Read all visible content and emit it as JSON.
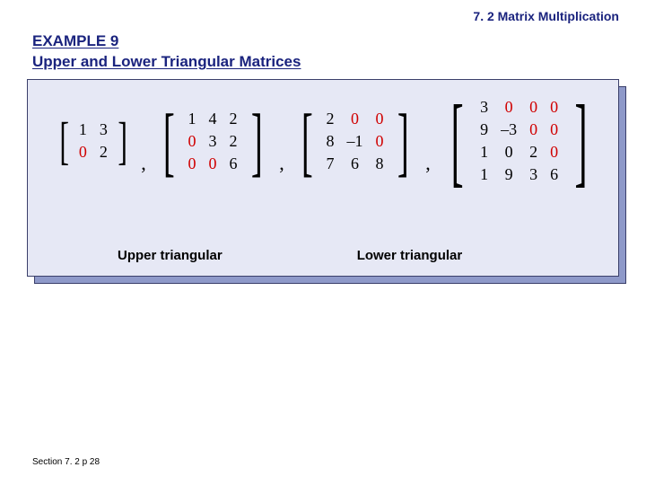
{
  "header": {
    "section": "7. 2 Matrix Multiplication"
  },
  "example": {
    "label": "EXAMPLE 9",
    "subtitle": "Upper and Lower Triangular Matrices"
  },
  "labels": {
    "upper": "Upper triangular",
    "lower": "Lower triangular"
  },
  "matrices": {
    "m1": {
      "r1c1": "1",
      "r1c2": "3",
      "r2c1": "0",
      "r2c2": "2"
    },
    "m2": {
      "r1c1": "1",
      "r1c2": "4",
      "r1c3": "2",
      "r2c1": "0",
      "r2c2": "3",
      "r2c3": "2",
      "r3c1": "0",
      "r3c2": "0",
      "r3c3": "6"
    },
    "m3": {
      "r1c1": "2",
      "r1c2": "0",
      "r1c3": "0",
      "r2c1": "8",
      "r2c2": "–1",
      "r2c3": "0",
      "r3c1": "7",
      "r3c2": "6",
      "r3c3": "8"
    },
    "m4": {
      "r1c1": "3",
      "r1c2": "0",
      "r1c3": "0",
      "r1c4": "0",
      "r2c1": "9",
      "r2c2": "–3",
      "r2c3": "0",
      "r2c4": "0",
      "r3c1": "1",
      "r3c2": "0",
      "r3c3": "2",
      "r3c4": "0",
      "r4c1": "1",
      "r4c2": "9",
      "r4c3": "3",
      "r4c4": "6"
    }
  },
  "punct": {
    "comma": ","
  },
  "footer": {
    "text": "Section 7. 2  p 28"
  }
}
